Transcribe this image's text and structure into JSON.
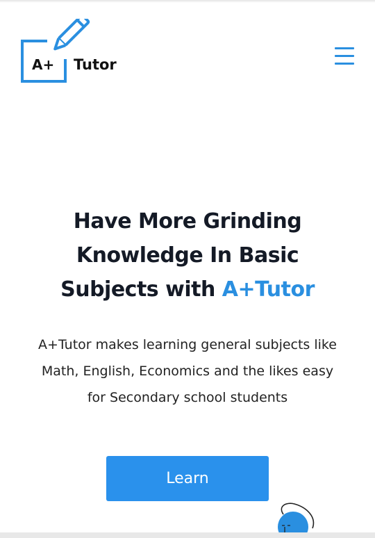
{
  "header": {
    "logo": {
      "prefix": "A+",
      "name": "Tutor"
    },
    "menu_icon": "hamburger-menu-icon"
  },
  "hero": {
    "title_lines": [
      "Have More Grinding",
      "Knowledge In Basic",
      "Subjects with "
    ],
    "title_accent": "A+Tutor",
    "description": "A+Tutor makes learning general subjects like Math, English, Economics and the likes easy for Secondary school students",
    "cta_label": "Learn"
  },
  "colors": {
    "accent": "#2a8fe0",
    "button": "#2a91ec",
    "text": "#141a26"
  }
}
